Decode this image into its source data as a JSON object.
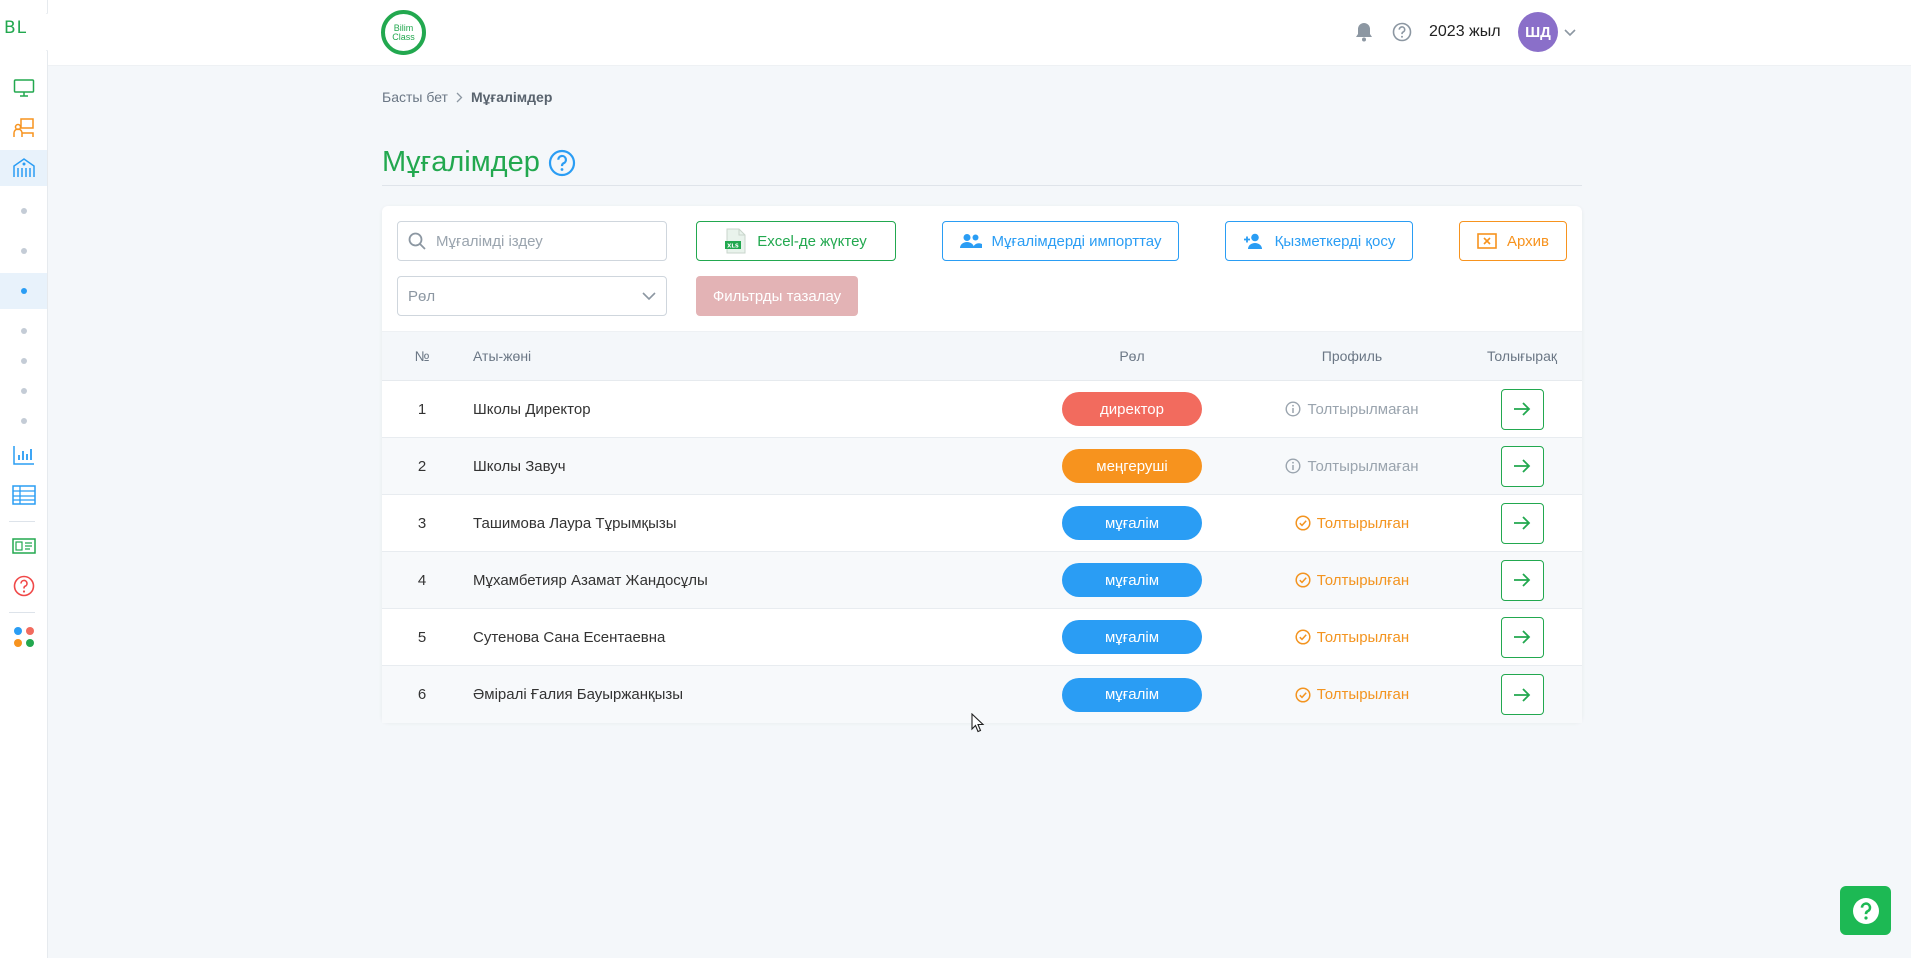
{
  "sidebar": {
    "logo_text": "BL",
    "expand_icon": "chevron-right-icon",
    "icons": [
      "monitor-icon",
      "classroom-icon",
      "school-icon",
      "chart-icon",
      "table-icon",
      "id-card-icon",
      "help-circle-icon",
      "apps-icon"
    ]
  },
  "header": {
    "logo_line1": "Bilim",
    "logo_line2": "Class",
    "year": "2023 жыл",
    "avatar_initials": "ШД"
  },
  "breadcrumb": {
    "home": "Басты бет",
    "current": "Мұғалімдер"
  },
  "page": {
    "title": "Мұғалімдер"
  },
  "toolbar": {
    "search_placeholder": "Мұғалімді іздеу",
    "role_placeholder": "Рөл",
    "excel_label": "Excel-де жүктеу",
    "excel_icon_text": "XLS",
    "import_label": "Мұғалімдерді импорттау",
    "add_label": "Қызметкерді қосу",
    "archive_label": "Архив",
    "clear_label": "Фильтрды тазалау"
  },
  "table": {
    "columns": {
      "num": "№",
      "name": "Аты-жөні",
      "role": "Рөл",
      "profile": "Профиль",
      "more": "Толығырақ"
    },
    "rows": [
      {
        "num": "1",
        "name": "Школы Директор",
        "role": "директор",
        "profile": "Толтырылмаған"
      },
      {
        "num": "2",
        "name": "Школы Завуч",
        "role": "меңгеруші",
        "profile": "Толтырылмаған"
      },
      {
        "num": "3",
        "name": "Ташимова Лаура Тұрымқызы",
        "role": "мұғалім",
        "profile": "Толтырылған"
      },
      {
        "num": "4",
        "name": "Мұхамбетияр Азамат Жандосұлы",
        "role": "мұғалім",
        "profile": "Толтырылған"
      },
      {
        "num": "5",
        "name": "Сутенова Сана Есентаевна",
        "role": "мұғалім",
        "profile": "Толтырылған"
      },
      {
        "num": "6",
        "name": "Әміралі Ғалия Бауыржанқызы",
        "role": "мұғалім",
        "profile": "Толтырылған"
      }
    ]
  },
  "colors": {
    "brand_green": "#22a84f",
    "accent_blue": "#2a9df4",
    "warning_orange": "#f7931e",
    "danger_red": "#f26b5e"
  }
}
